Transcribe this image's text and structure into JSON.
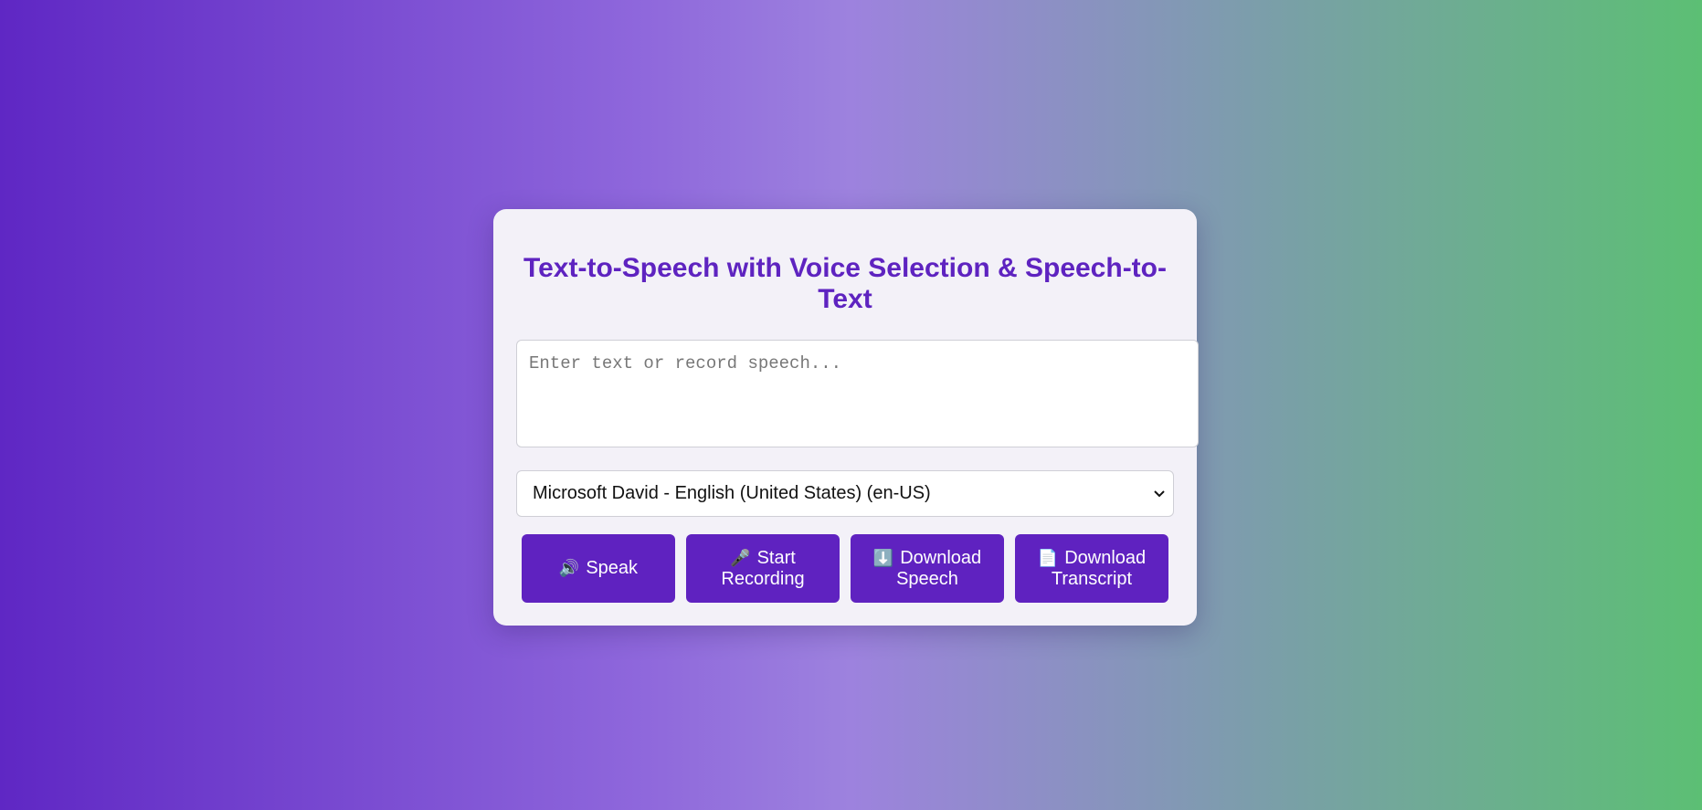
{
  "app": {
    "title": "Text-to-Speech with Voice Selection & Speech-to-Text"
  },
  "input": {
    "value": "",
    "placeholder": "Enter text or record speech..."
  },
  "voice_select": {
    "selected": "Microsoft David - English (United States) (en-US)"
  },
  "buttons": {
    "speak": {
      "icon": "🔊",
      "icon_name": "speaker-icon",
      "label": "Speak"
    },
    "record": {
      "icon": "🎤",
      "icon_name": "microphone-icon",
      "label": "Start Recording"
    },
    "download_speech": {
      "icon": "⬇️",
      "icon_name": "download-arrow-icon",
      "label": "Download Speech"
    },
    "download_transcript": {
      "icon": "📄",
      "icon_name": "document-icon",
      "label": "Download Transcript"
    }
  },
  "colors": {
    "accent": "#5f22c0",
    "card_background": "#f3f1f8",
    "gradient_start": "#5f27c4",
    "gradient_end": "#5cbf74"
  }
}
